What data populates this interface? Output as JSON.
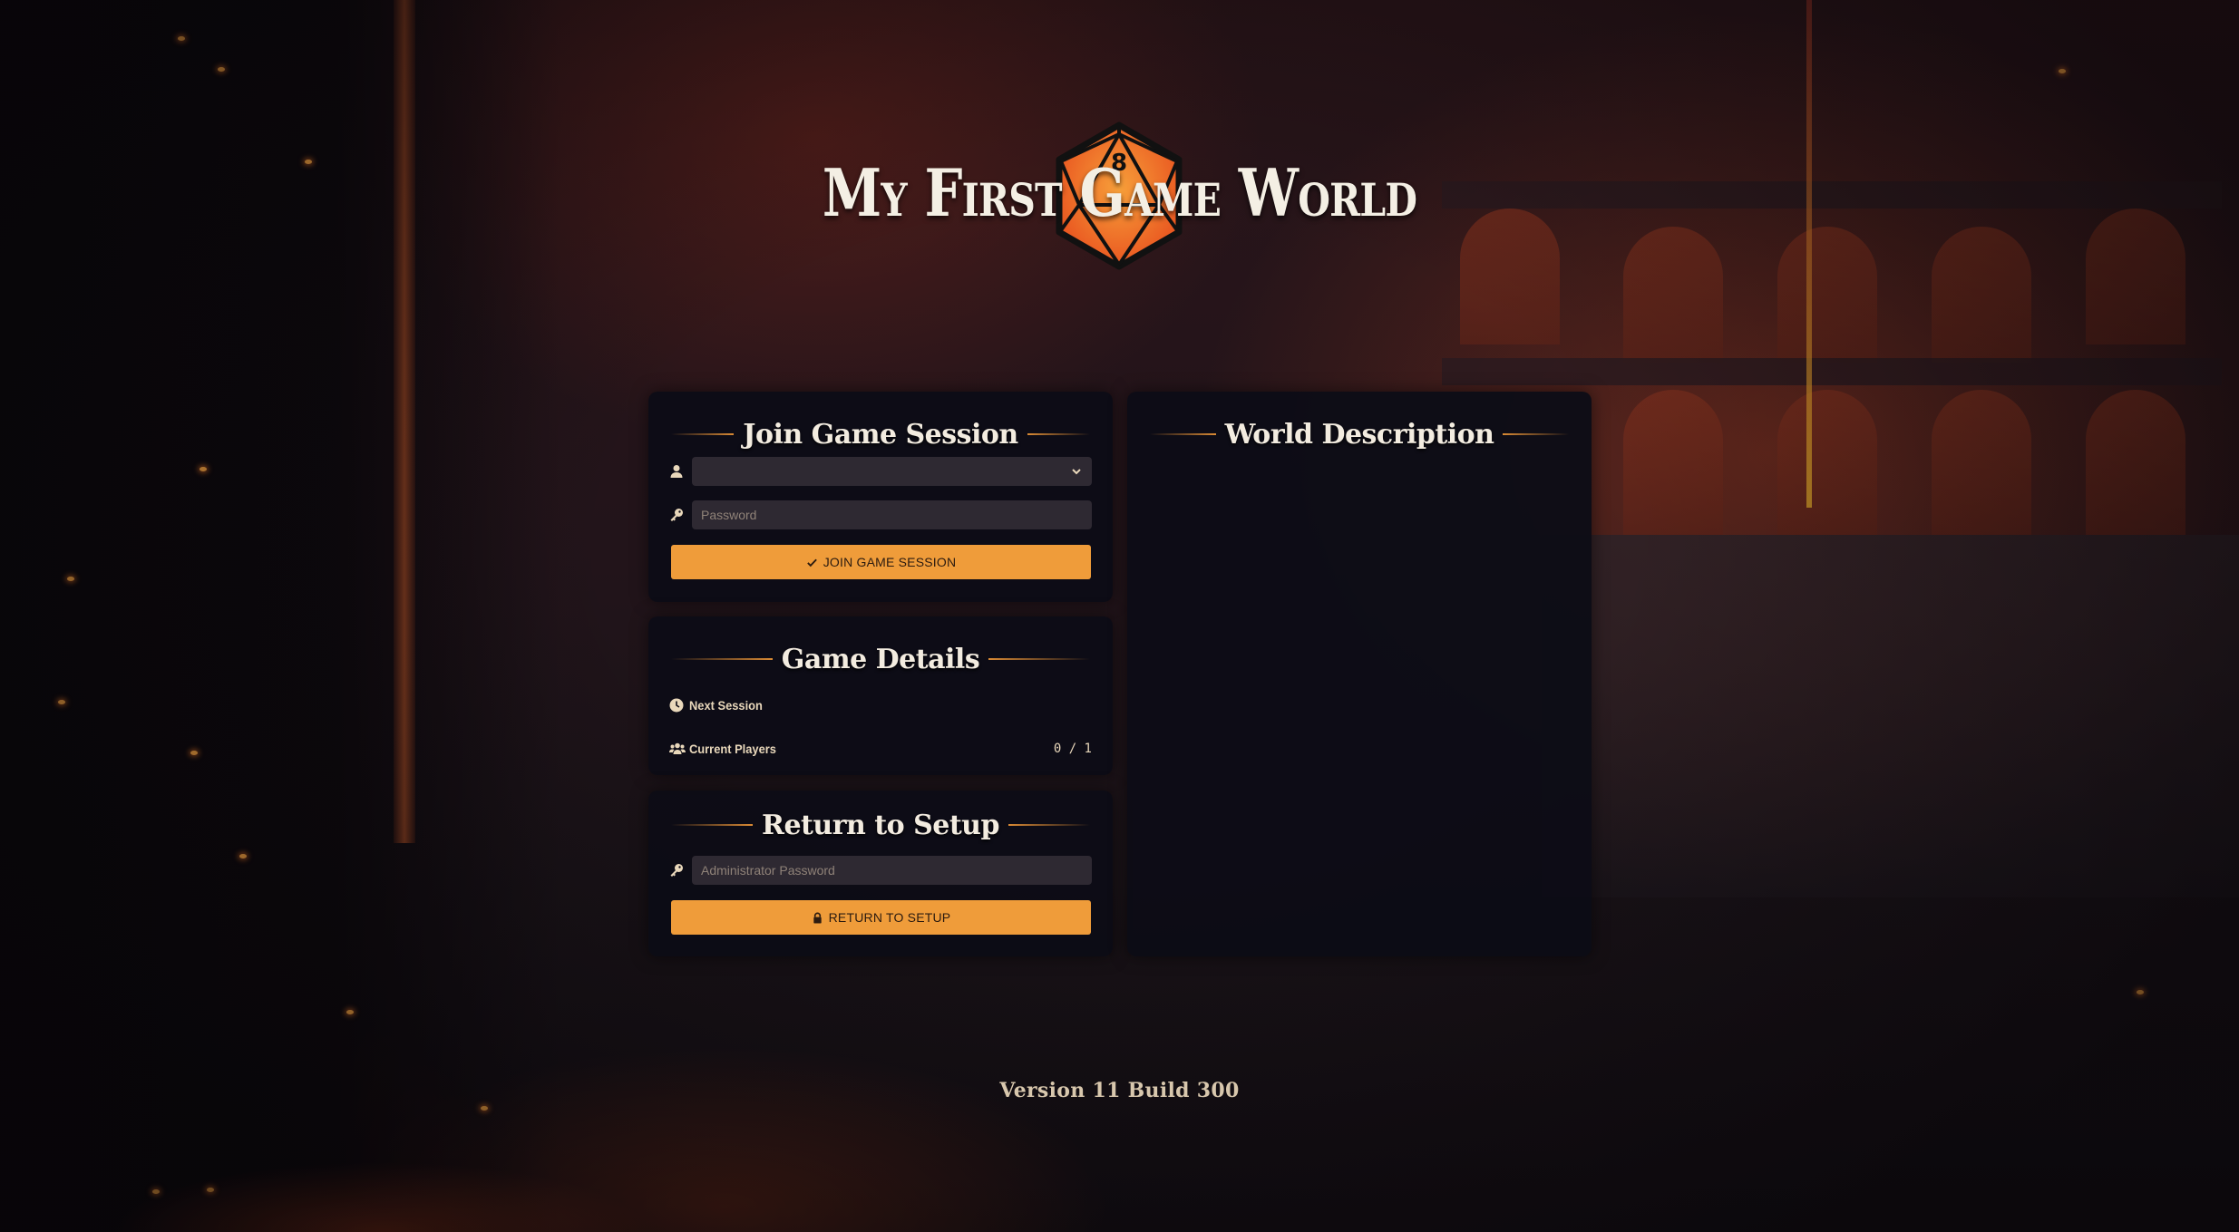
{
  "world": {
    "title": "My First Game World",
    "die_face": "8"
  },
  "join": {
    "heading": "Join Game Session",
    "user_select": {
      "selected": ""
    },
    "password": {
      "placeholder": "Password",
      "value": ""
    },
    "button_label": "JOIN GAME SESSION",
    "icons": {
      "user": "user-icon",
      "password": "key-icon",
      "button": "check-icon"
    }
  },
  "details": {
    "heading": "Game Details",
    "next_session": {
      "label": "Next Session",
      "value": "",
      "icon": "clock-icon"
    },
    "current_players": {
      "label": "Current Players",
      "value": "0 / 1",
      "icon": "users-icon"
    }
  },
  "setup": {
    "heading": "Return to Setup",
    "admin_password": {
      "placeholder": "Administrator Password",
      "value": ""
    },
    "button_label": "RETURN TO SETUP",
    "icons": {
      "password": "key-icon",
      "button": "lock-icon"
    }
  },
  "world_description": {
    "heading": "World Description",
    "body": ""
  },
  "footer": {
    "version": "Version 11 Build 300"
  },
  "colors": {
    "accent": "#ef9c3a",
    "panel_bg": "#0d0c16",
    "input_bg": "#2e2932",
    "heading_text": "#f3ece0",
    "label_text": "#e9d8bb"
  }
}
